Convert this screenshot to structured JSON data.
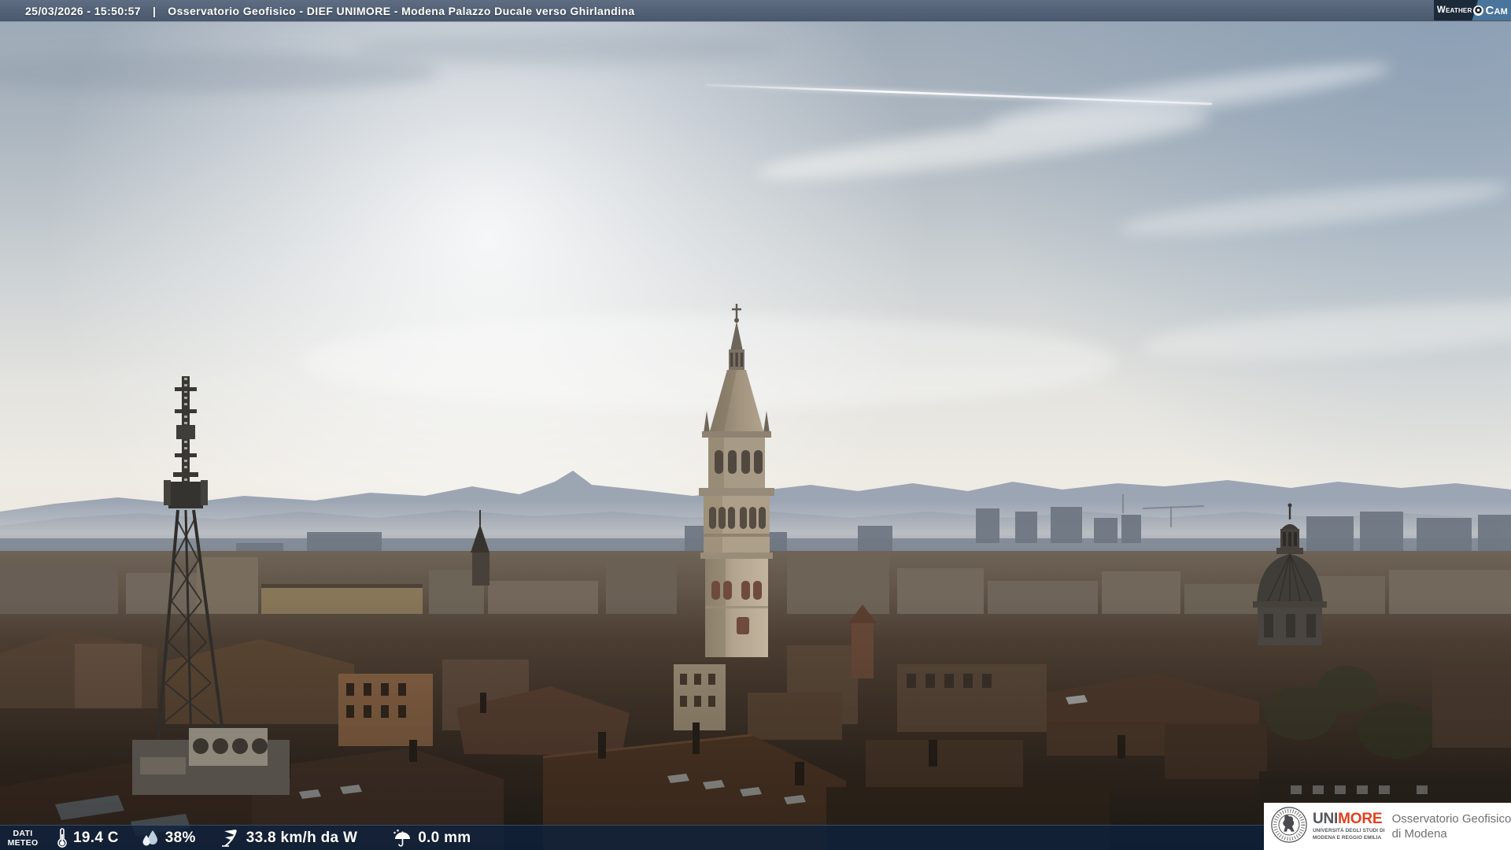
{
  "header": {
    "timestamp": "25/03/2026 - 15:50:57",
    "separator": "|",
    "title": "Osservatorio Geofisico - DIEF UNIMORE - Modena Palazzo Ducale verso Ghirlandina",
    "weathercam": {
      "brand_weather": "Weather",
      "brand_cam": "Cam"
    }
  },
  "footer": {
    "dati_meteo": {
      "line1": "DATI",
      "line2": "METEO"
    },
    "readings": {
      "temperature": {
        "icon": "thermometer-icon",
        "value": "19.4 C"
      },
      "humidity": {
        "icon": "humidity-drops-icon",
        "value": "38%"
      },
      "wind": {
        "icon": "wind-flag-icon",
        "value": "33.8 km/h da W"
      },
      "rain": {
        "icon": "umbrella-rain-icon",
        "value": "0.0 mm"
      }
    }
  },
  "logo_box": {
    "unimore_uni": "UNI",
    "unimore_more": "MORE",
    "subtitle_line1": "UNIVERSITÀ DEGLI STUDI DI",
    "subtitle_line2": "MODENA E REGGIO EMILIA",
    "org_line1": "Osservatorio Geofisico",
    "org_line2": "di Modena"
  },
  "scene": {
    "description": "Hazy afternoon webcam view over Modena rooftops: Ghirlandina tower centre, telecom lattice mast left, church dome right, Apennine ridge and jet contrail in the sky",
    "landmarks": [
      "ghirlandina-tower",
      "telecom-mast",
      "church-dome",
      "apennine-ridge",
      "jet-contrail"
    ],
    "colors": {
      "sky_top": "#9ba8b6",
      "sun_glow": "#ffffff",
      "mountains": "#97a1b0",
      "rooftops_dark": "#3a2e25",
      "bar_navy": "#0d213d",
      "topbar_slate": "#54647a",
      "weathercam_navy": "#1d2a3a",
      "weathercam_blue": "#49749c",
      "unimore_orange": "#e2401c",
      "unimore_gray": "#54565a",
      "org_text_gray": "#6e7073"
    }
  }
}
